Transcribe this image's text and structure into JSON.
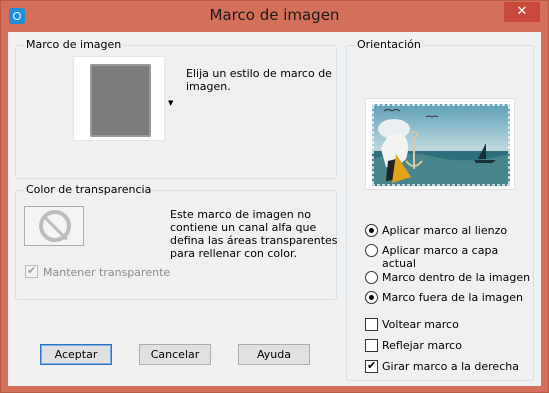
{
  "window": {
    "title": "Marco de imagen",
    "close_glyph": "✕",
    "accent_color": "#d46f5a",
    "close_color": "#c7493a"
  },
  "frame_group": {
    "title": "Marco de imagen",
    "description": "Elija un estilo de marco de imagen."
  },
  "transparency_group": {
    "title": "Color de transparencia",
    "message": "Este marco de imagen no contiene un canal alfa que defina las áreas transparentes para rellenar con color.",
    "keep_transparent_label": "Mantener transparente",
    "keep_transparent_checked": true,
    "keep_transparent_enabled": false
  },
  "orientation_group": {
    "title": "Orientación",
    "apply_options": [
      {
        "label": "Aplicar marco al lienzo",
        "checked": true
      },
      {
        "label": "Aplicar marco a capa actual",
        "checked": false
      }
    ],
    "placement_options": [
      {
        "label": "Marco dentro de la imagen",
        "checked": false
      },
      {
        "label": "Marco fuera de la imagen",
        "checked": true
      }
    ],
    "checkboxes": [
      {
        "label": "Voltear marco",
        "checked": false
      },
      {
        "label": "Reflejar marco",
        "checked": false
      },
      {
        "label": "Girar marco a la derecha",
        "checked": true
      }
    ]
  },
  "buttons": {
    "accept": "Aceptar",
    "cancel": "Cancelar",
    "help": "Ayuda"
  },
  "icons": {
    "app": "app-icon",
    "dropdown": "dropdown-arrow-icon",
    "no_transparency": "no-entry-icon"
  }
}
